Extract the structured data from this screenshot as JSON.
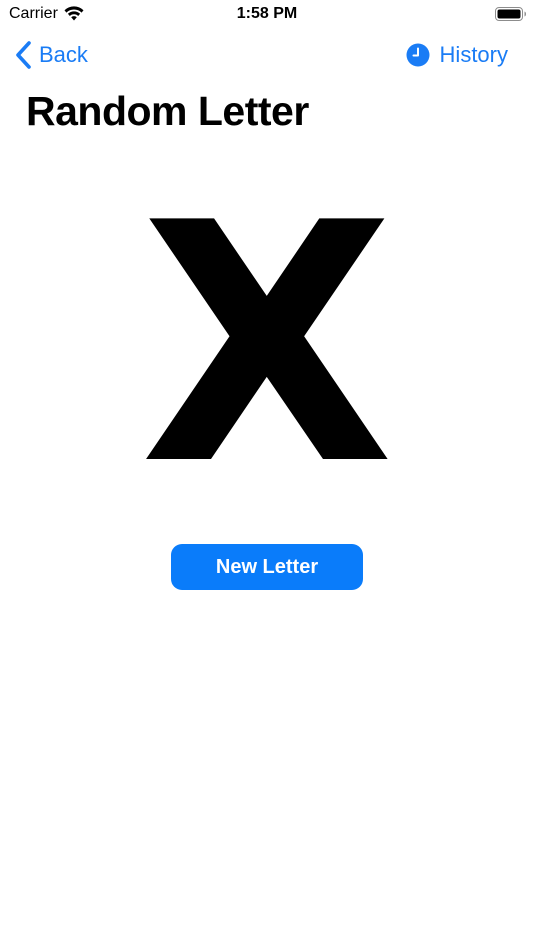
{
  "status_bar": {
    "carrier": "Carrier",
    "time": "1:58 PM",
    "wifi_icon": "wifi-icon",
    "battery_icon": "battery-icon"
  },
  "nav": {
    "back_label": "Back",
    "back_icon": "chevron-left-icon",
    "history_label": "History",
    "history_icon": "clock-icon"
  },
  "page": {
    "title": "Random Letter",
    "letter": "X"
  },
  "actions": {
    "new_letter_label": "New Letter"
  },
  "colors": {
    "accent": "#1a7cf5",
    "button_bg": "#0a7cfa",
    "text": "#000000",
    "background": "#ffffff"
  }
}
